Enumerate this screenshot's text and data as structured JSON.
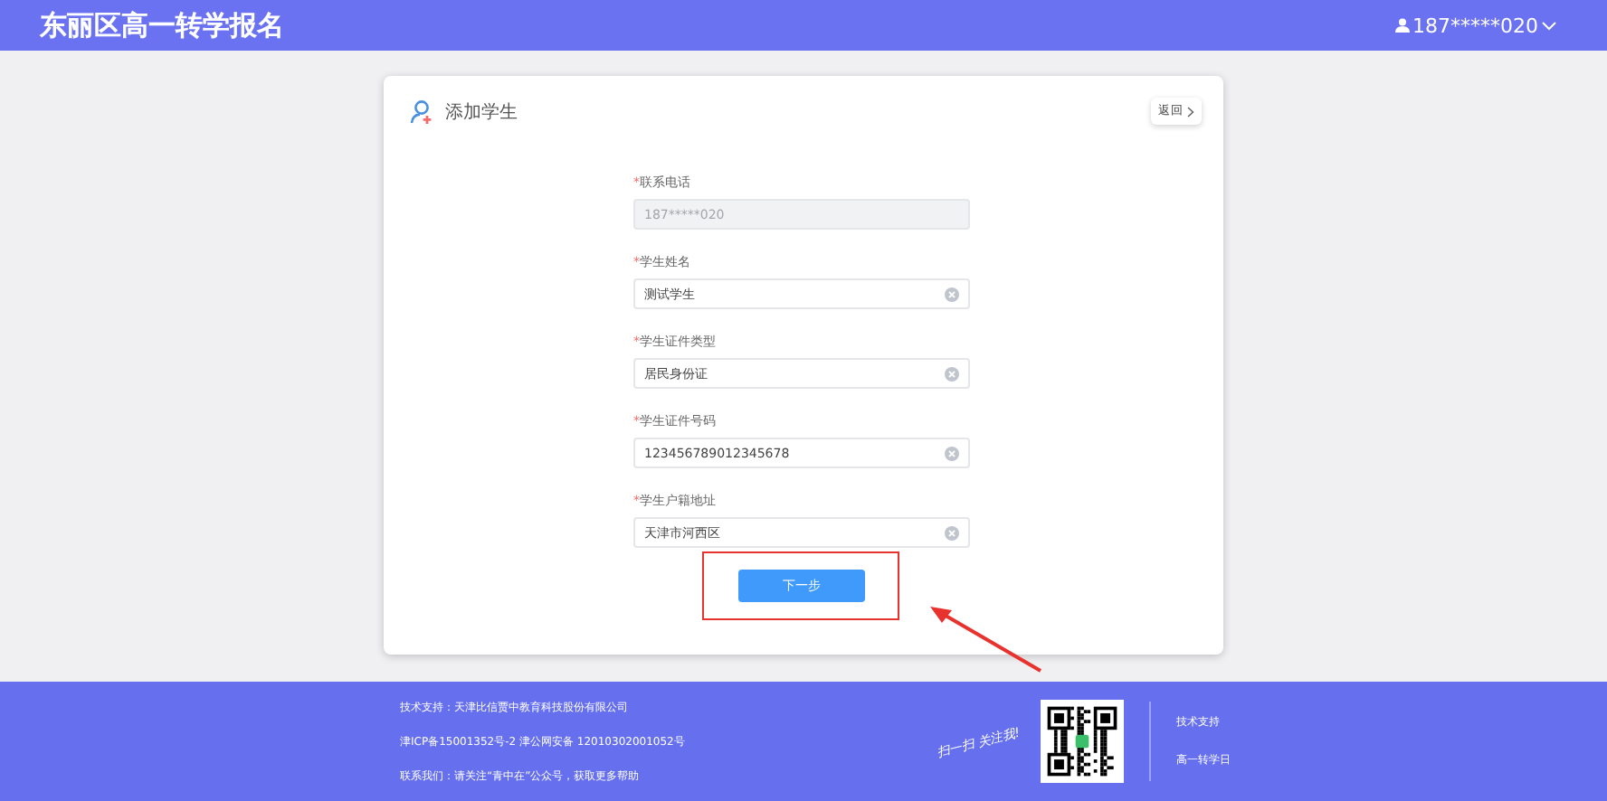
{
  "header": {
    "title": "东丽区高一转学报名",
    "user": "187*****020"
  },
  "card": {
    "title": "添加学生",
    "back_button": "返回",
    "fields": [
      {
        "mark": "*",
        "label": "联系电话",
        "value": "187*****020",
        "disabled": true,
        "clearable": false
      },
      {
        "mark": "*",
        "label": "学生姓名",
        "value": "测试学生",
        "disabled": false,
        "clearable": true
      },
      {
        "mark": "*",
        "label": "学生证件类型",
        "value": "居民身份证",
        "disabled": false,
        "clearable": true
      },
      {
        "mark": "*",
        "label": "学生证件号码",
        "value": "123456789012345678",
        "disabled": false,
        "clearable": true
      },
      {
        "mark": "*",
        "label": "学生户籍地址",
        "value": "天津市河西区",
        "disabled": false,
        "clearable": true
      }
    ],
    "next_button": "下一步"
  },
  "footer": {
    "lines": [
      "技术支持：天津比信贾中教育科技股份有限公司",
      "津ICP备15001352号-2 津公网安备 12010302001052号",
      "联系我们：请关注“青中在”公众号，获取更多帮助"
    ],
    "qr_caption": "扫一扫 关注我!",
    "links": [
      "技术支持",
      "高一转学日"
    ]
  }
}
